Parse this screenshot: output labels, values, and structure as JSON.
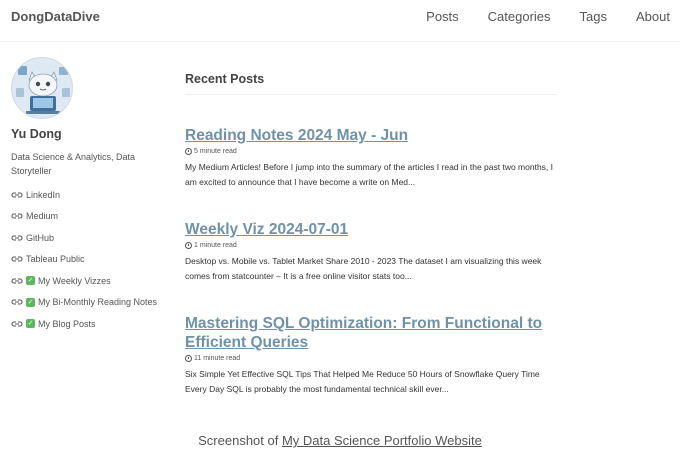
{
  "header": {
    "site_title": "DongDataDive",
    "nav": [
      "Posts",
      "Categories",
      "Tags",
      "About"
    ]
  },
  "sidebar": {
    "author_name": "Yu Dong",
    "bio": "Data Science & Analytics, Data Storyteller",
    "links": [
      {
        "label": "LinkedIn",
        "check": false
      },
      {
        "label": "Medium",
        "check": false
      },
      {
        "label": "GitHub",
        "check": false
      },
      {
        "label": "Tableau Public",
        "check": false
      },
      {
        "label": "My Weekly Vizzes",
        "check": true
      },
      {
        "label": "My Bi-Monthly Reading Notes",
        "check": true
      },
      {
        "label": "My Blog Posts",
        "check": true
      }
    ]
  },
  "main": {
    "section_title": "Recent Posts",
    "posts": [
      {
        "title": "Reading Notes 2024 May - Jun",
        "read_time": "5 minute read",
        "excerpt": "My Medium Articles! Before I jump into the summary of the articles I read in the past two months, I am excited to announce that I have become a write on Med..."
      },
      {
        "title": "Weekly Viz 2024-07-01",
        "read_time": "1 minute read",
        "excerpt": "Desktop vs. Mobile vs. Tablet Market Share 2010 - 2023 The dataset I am visualizing this week comes from statcounter – It is a free online visitor stats too..."
      },
      {
        "title": "Mastering SQL Optimization: From Functional to Efficient Queries",
        "read_time": "11 minute read",
        "excerpt": "Six Simple Yet Effective SQL Tips That Helped Me Reduce 50 Hours of Snowflake Query Time Every Day SQL is probably the most fundamental technical skill ever..."
      }
    ]
  },
  "caption": {
    "prefix": "Screenshot of ",
    "link_text": "My Data Science Portfolio Website"
  },
  "colors": {
    "post_title": "#6f92a8",
    "check": "#5cb85c"
  },
  "icons": {
    "avatar": "robot-avatar",
    "link": "link-icon",
    "check": "check-mark-icon",
    "read_time": "clock-icon"
  }
}
